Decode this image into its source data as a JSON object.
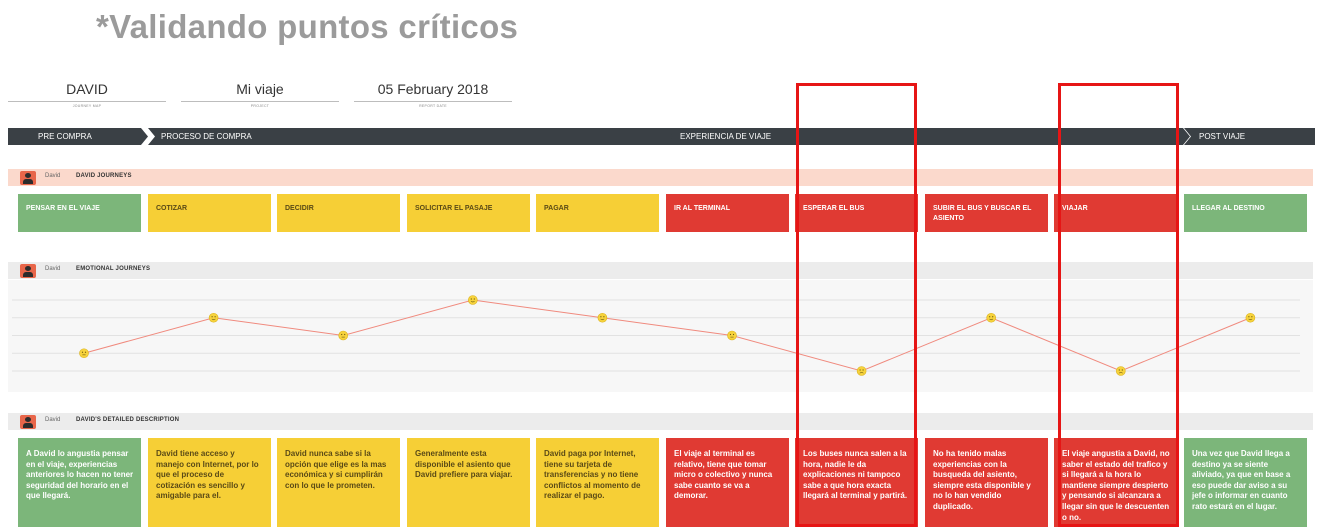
{
  "title": "*Validando puntos críticos",
  "header": {
    "fields": [
      {
        "value": "DAVID",
        "caption": "JOURNEY MAP"
      },
      {
        "value": "Mi viaje",
        "caption": "PROJECT"
      },
      {
        "value": "05 February 2018",
        "caption": "REPORT DATE"
      }
    ]
  },
  "stages": [
    "PRE COMPRA",
    "PROCESO DE COMPRA",
    "EXPERIENCIA DE VIAJE",
    "POST VIAJE"
  ],
  "bands": {
    "journeys": {
      "who": "David",
      "label": "DAVID JOURNEYS"
    },
    "emotional": {
      "who": "David",
      "label": "EMOTIONAL JOURNEYS"
    },
    "detailed": {
      "who": "David",
      "label": "DAVID'S DETAILED DESCRIPTION"
    }
  },
  "steps": [
    {
      "label": "PENSAR EN EL VIAJE",
      "color": "green"
    },
    {
      "label": "COTIZAR",
      "color": "yellow"
    },
    {
      "label": "DECIDIR",
      "color": "yellow"
    },
    {
      "label": "SOLICITAR EL PASAJE",
      "color": "yellow"
    },
    {
      "label": "PAGAR",
      "color": "yellow"
    },
    {
      "label": "IR AL TERMINAL",
      "color": "red"
    },
    {
      "label": "ESPERAR EL BUS",
      "color": "red"
    },
    {
      "label": "SUBIR EL BUS Y BUSCAR EL ASIENTO",
      "color": "red"
    },
    {
      "label": "VIAJAR",
      "color": "red"
    },
    {
      "label": "LLEGAR AL DESTINO",
      "color": "green"
    }
  ],
  "descriptions": [
    "A David lo angustia pensar en el viaje, experiencias anteriores lo hacen no tener seguridad del horario en el que llegará.",
    "David tiene acceso y manejo con Internet, por lo que el proceso de cotización es sencillo y amigable para el.",
    "David nunca sabe si la opción que elige es la mas económica y si cumplirán con lo que le prometen.",
    "Generalmente esta disponible el asiento que David prefiere para viajar.",
    "David paga por Internet, tiene su tarjeta de transferencias y no tiene conflictos al momento de realizar el pago.",
    "El viaje al terminal es relativo, tiene que tomar micro o colectivo y nunca sabe cuanto se va a demorar.",
    "Los buses nunca salen a la hora, nadie le da explicaciones ni tampoco sabe a que hora exacta llegará al terminal y partirá.",
    "No ha tenido malas experiencias con la busqueda del asiento, siempre esta disponible y no lo han vendido duplicado.",
    "El viaje angustia a David, no saber el estado del trafico y si llegará a la hora lo mantiene siempre despierto y pensando si alcanzara a llegar sin que le descuenten o no.",
    "Una vez que David llega a destino ya se siente aliviado, ya que en base a eso puede dar aviso a su jefe o informar en cuanto rato estará en el lugar."
  ],
  "chart_data": {
    "type": "line",
    "categories": [
      "PENSAR EN EL VIAJE",
      "COTIZAR",
      "DECIDIR",
      "SOLICITAR EL PASAJE",
      "PAGAR",
      "IR AL TERMINAL",
      "ESPERAR EL BUS",
      "SUBIR EL BUS Y BUSCAR EL ASIENTO",
      "VIAJAR",
      "LLEGAR AL DESTINO"
    ],
    "series": [
      {
        "values": [
          1,
          3,
          2,
          4,
          3,
          2,
          0,
          3,
          0,
          3
        ]
      }
    ],
    "ylim": [
      0,
      4
    ],
    "grid": true,
    "line_color": "#f08a7e",
    "marker_color": "#f7d33c"
  },
  "colors": {
    "green": "#7cb67a",
    "yellow": "#f6cf36",
    "red": "#e03a33",
    "highlight": "#e61515",
    "stage_bar": "#3a4045"
  }
}
